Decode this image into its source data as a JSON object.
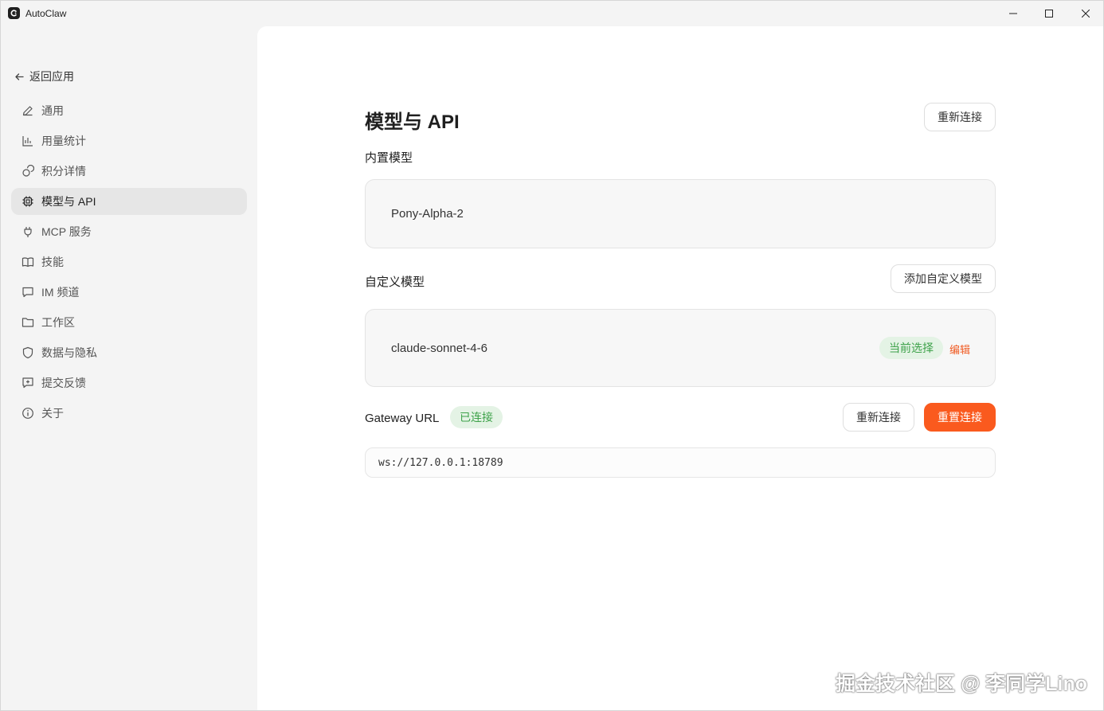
{
  "window": {
    "title": "AutoClaw"
  },
  "sidebar": {
    "back_label": "返回应用",
    "items": [
      {
        "label": "通用",
        "icon": "pencil-icon"
      },
      {
        "label": "用量统计",
        "icon": "bar-chart-icon"
      },
      {
        "label": "积分详情",
        "icon": "coins-icon"
      },
      {
        "label": "模型与 API",
        "icon": "chip-icon",
        "active": true
      },
      {
        "label": "MCP 服务",
        "icon": "plug-icon"
      },
      {
        "label": "技能",
        "icon": "book-icon"
      },
      {
        "label": "IM 频道",
        "icon": "message-icon"
      },
      {
        "label": "工作区",
        "icon": "folder-icon"
      },
      {
        "label": "数据与隐私",
        "icon": "shield-icon"
      },
      {
        "label": "提交反馈",
        "icon": "feedback-icon"
      },
      {
        "label": "关于",
        "icon": "info-icon"
      }
    ]
  },
  "main": {
    "title": "模型与 API",
    "reconnect_top_label": "重新连接",
    "builtin": {
      "label": "内置模型",
      "model": "Pony-Alpha-2"
    },
    "custom": {
      "label": "自定义模型",
      "add_label": "添加自定义模型",
      "model": "claude-sonnet-4-6",
      "badge": "当前选择",
      "edit_label": "编辑"
    },
    "gateway": {
      "label": "Gateway URL",
      "status": "已连接",
      "reconnect_label": "重新连接",
      "reset_label": "重置连接",
      "url": "ws://127.0.0.1:18789"
    }
  },
  "watermark": "掘金技术社区 @ 李同学Lino",
  "colors": {
    "accent": "#fa5a1e",
    "success_bg": "#e4f3e5",
    "success_text": "#3ea24a",
    "active_nav_bg": "#e6e6e6"
  }
}
